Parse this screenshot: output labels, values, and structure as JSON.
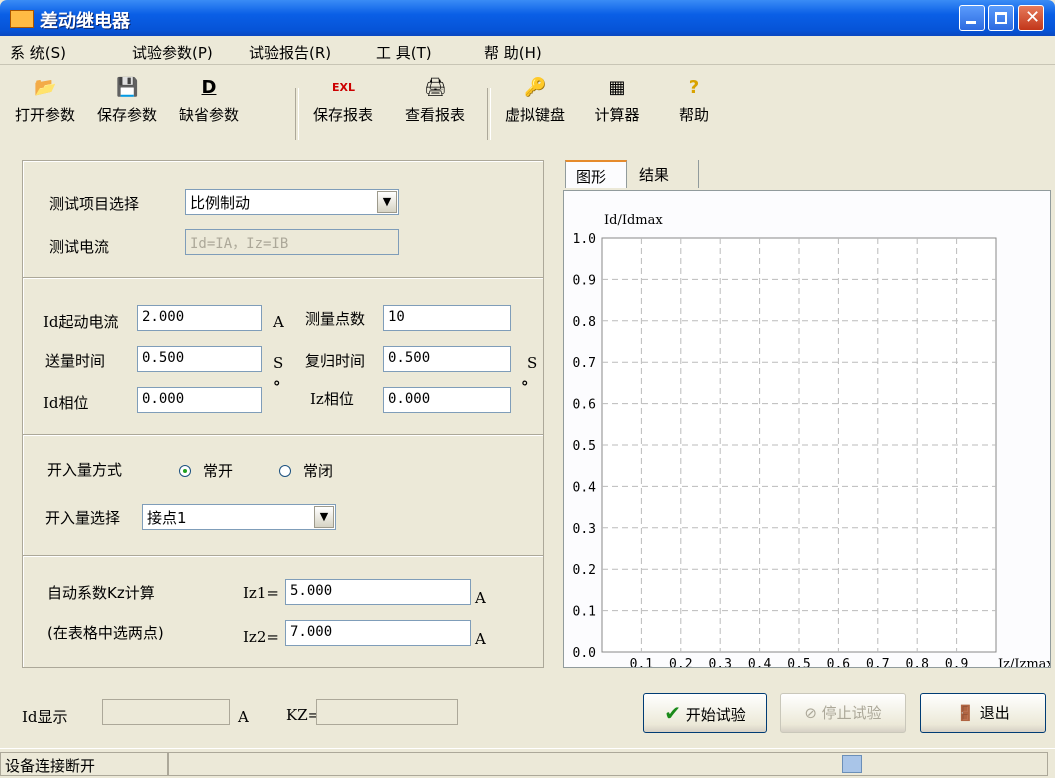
{
  "window": {
    "title": "差动继电器"
  },
  "menu": [
    "系 统(S)",
    "试验参数(P)",
    "试验报告(R)",
    "工 具(T)",
    "帮 助(H)"
  ],
  "toolbar": [
    {
      "label": "打开参数",
      "icon": "folder-open-icon"
    },
    {
      "label": "保存参数",
      "icon": "floppy-disk-icon"
    },
    {
      "label": "缺省参数",
      "icon": "default-D-icon"
    },
    {
      "label": "保存报表",
      "icon": "excel-icon"
    },
    {
      "label": "查看报表",
      "icon": "printer-icon"
    },
    {
      "label": "虚拟键盘",
      "icon": "key-icon"
    },
    {
      "label": "计算器",
      "icon": "calculator-icon"
    },
    {
      "label": "帮助",
      "icon": "help-icon"
    }
  ],
  "left": {
    "test_item_label": "测试项目选择",
    "test_item_value": "比例制动",
    "test_current_label": "测试电流",
    "test_current_value": "Id=IA，Iz=IB",
    "id_start_label": "Id起动电流",
    "id_start_value": "2.000",
    "id_start_unit": "A",
    "points_label": "测量点数",
    "points_value": "10",
    "send_time_label": "送量时间",
    "send_time_value": "0.500",
    "send_time_unit": "S",
    "reset_time_label": "复归时间",
    "reset_time_value": "0.500",
    "reset_time_unit": "S",
    "id_phase_label": "Id相位",
    "id_phase_value": "0.000",
    "id_phase_unit": "°",
    "iz_phase_label": "Iz相位",
    "iz_phase_value": "0.000",
    "iz_phase_unit": "°",
    "input_mode_label": "开入量方式",
    "mode_no": "常开",
    "mode_nc": "常闭",
    "input_select_label": "开入量选择",
    "input_select_value": "接点1",
    "auto_kz_label": "自动系数Kz计算",
    "auto_kz_hint": "(在表格中选两点)",
    "iz1_label": "Iz1=",
    "iz1_value": "5.000",
    "iz1_unit": "A",
    "iz2_label": "Iz2=",
    "iz2_value": "7.000",
    "iz2_unit": "A"
  },
  "tabs": [
    "图形",
    "结果"
  ],
  "chart_data": {
    "type": "line",
    "ylabel": "Id/Idmax",
    "xlabel": "Iz/Izmax",
    "ylim": [
      0,
      1.0
    ],
    "xlim": [
      0,
      1.0
    ],
    "y_ticks": [
      "0.0",
      "0.1",
      "0.2",
      "0.3",
      "0.4",
      "0.5",
      "0.6",
      "0.7",
      "0.8",
      "0.9",
      "1.0"
    ],
    "x_ticks": [
      "0.1",
      "0.2",
      "0.3",
      "0.4",
      "0.5",
      "0.6",
      "0.7",
      "0.8",
      "0.9"
    ],
    "grid": true,
    "series": []
  },
  "bottom": {
    "id_display_label": "Id显示",
    "id_display_value": "",
    "id_display_unit": "A",
    "kz_label": "KZ=",
    "kz_value": "",
    "start_button": "开始试验",
    "stop_button": "停止试验",
    "exit_button": "退出"
  },
  "status": {
    "text": "设备连接断开"
  }
}
